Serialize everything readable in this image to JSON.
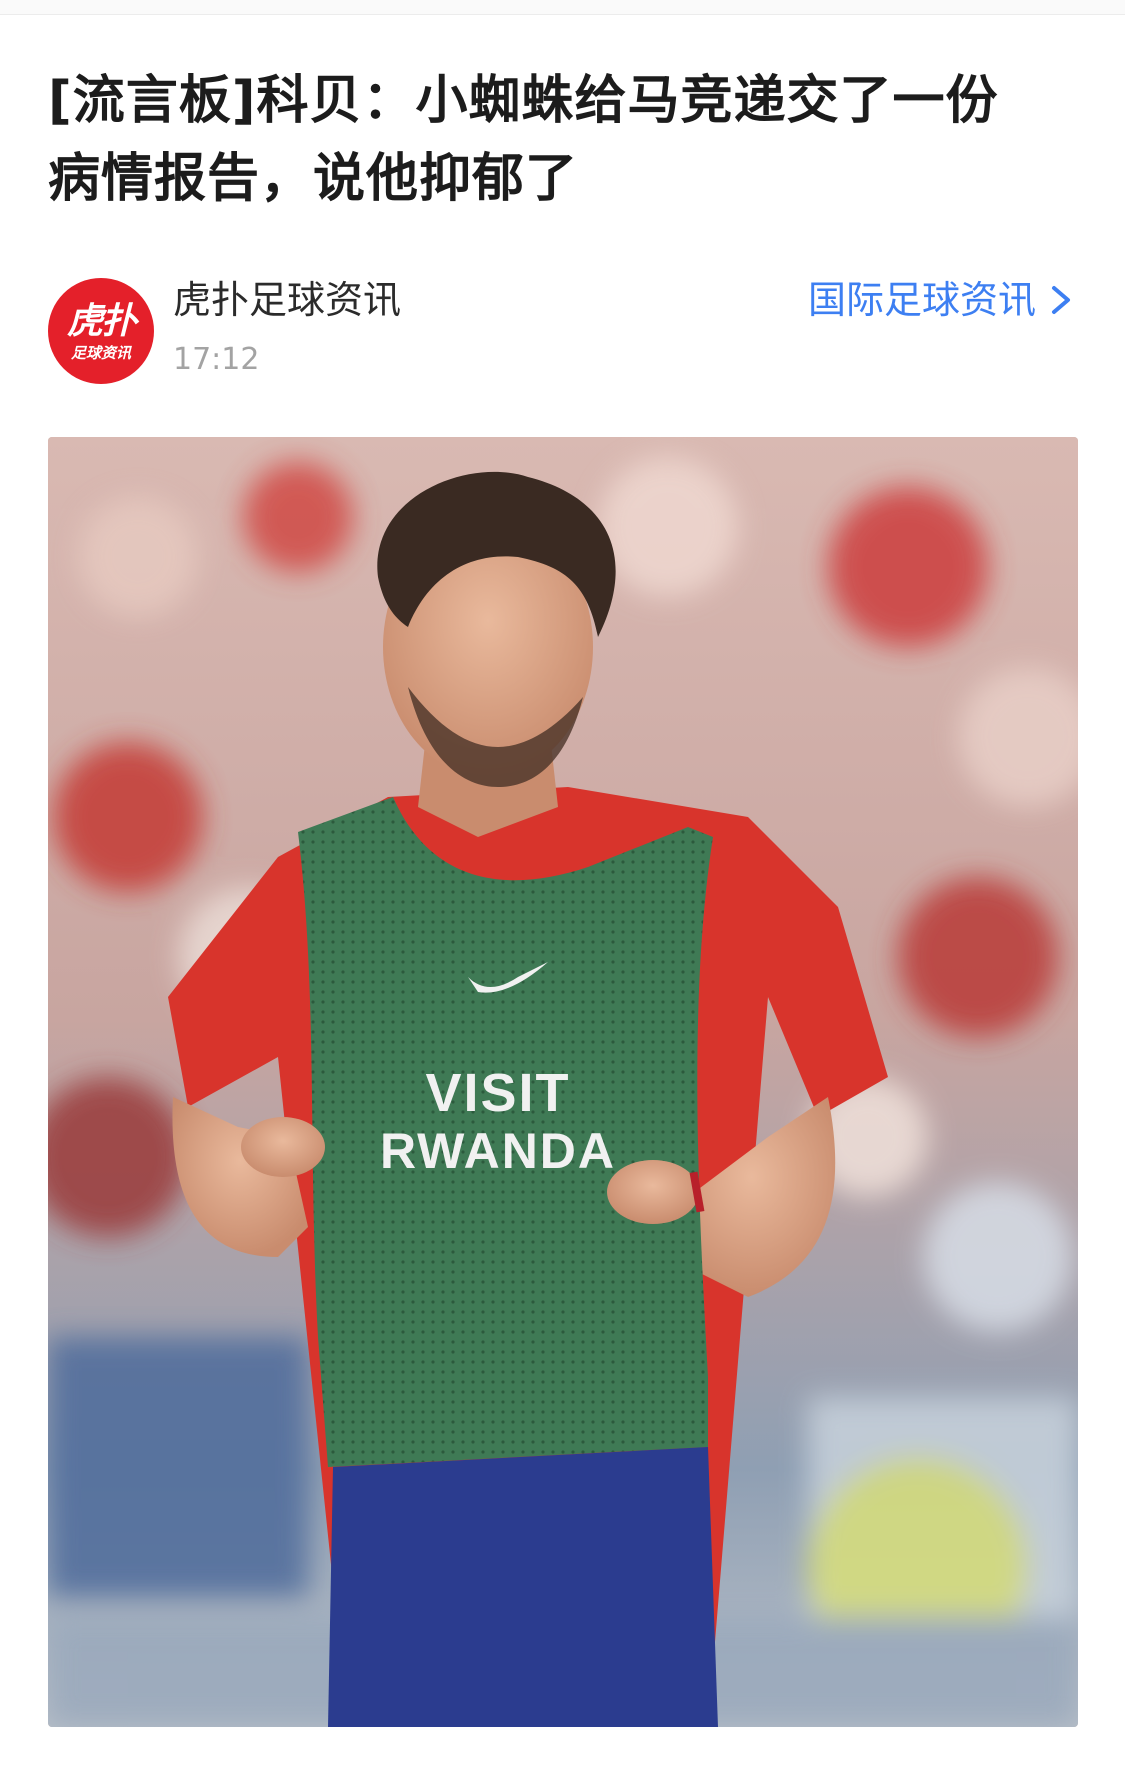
{
  "article": {
    "title": "[流言板]科贝：小蜘蛛给马竞递交了一份病情报告，说他抑郁了"
  },
  "author": {
    "logo_main": "虎扑",
    "logo_sub": "足球资讯",
    "name": "虎扑足球资讯",
    "time": "17:12"
  },
  "category": {
    "label": "国际足球资讯",
    "icon": "chevron-right-icon"
  },
  "photo": {
    "bib_line1": "VISIT",
    "bib_line2": "RWANDA",
    "colors": {
      "shirt": "#d8342c",
      "bib": "#3f7a55",
      "shorts": "#2b3c8f"
    }
  },
  "colors": {
    "link": "#3d7ff2",
    "brand": "#e4202a",
    "title": "#1c1c1c",
    "muted": "#a3a3a3"
  }
}
